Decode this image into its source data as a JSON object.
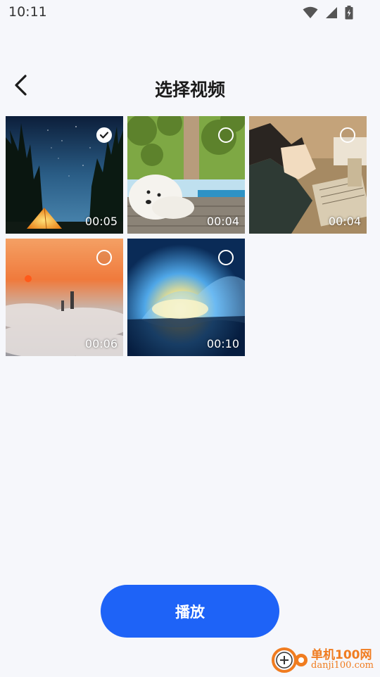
{
  "status_bar": {
    "time": "10:11",
    "icons": [
      "wifi-icon",
      "cell-signal-icon",
      "battery-charging-icon"
    ]
  },
  "header": {
    "back_icon": "chevron-left-icon",
    "title": "选择视频"
  },
  "videos": [
    {
      "duration": "00:05",
      "selected": true,
      "scene": "starry-night-tent"
    },
    {
      "duration": "00:04",
      "selected": false,
      "scene": "puppy-on-deck"
    },
    {
      "duration": "00:04",
      "selected": false,
      "scene": "anime-boy-drawing"
    },
    {
      "duration": "00:06",
      "selected": false,
      "scene": "sunrise-sea-of-clouds"
    },
    {
      "duration": "00:10",
      "selected": false,
      "scene": "blue-fire-burst"
    }
  ],
  "play_button": {
    "label": "播放"
  },
  "watermark": {
    "brand": "单机100网",
    "url": "danji100.com"
  },
  "colors": {
    "background": "#f6f7fb",
    "accent": "#1e63f7",
    "watermark": "#f07c20"
  }
}
